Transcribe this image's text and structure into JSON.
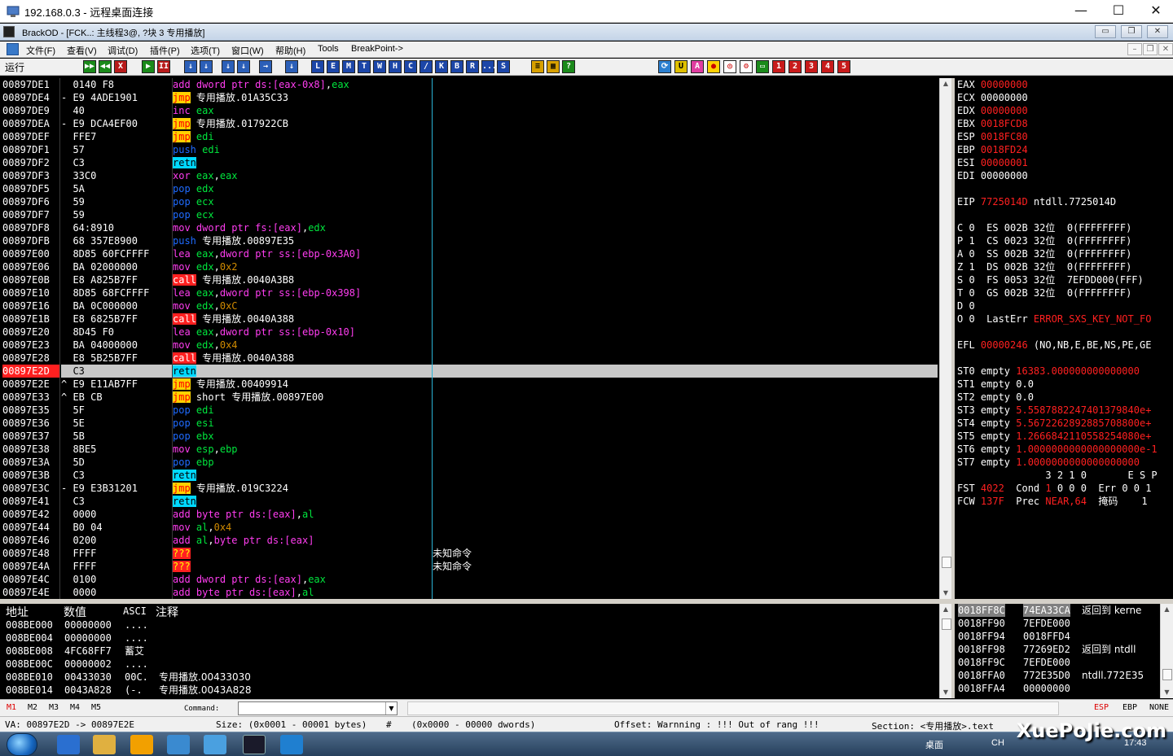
{
  "rdp": {
    "title": "192.168.0.3 - 远程桌面连接",
    "min": "—",
    "max": "☐",
    "close": "✕"
  },
  "od": {
    "title": "BrackOD - [FCK..: 主线程3@, ?块 3 专用播放]"
  },
  "menu": [
    "文件(F)",
    "查看(V)",
    "调试(D)",
    "插件(P)",
    "选项(T)",
    "窗口(W)",
    "帮助(H)",
    "Tools",
    "BreakPoint->"
  ],
  "toolbar": {
    "status": "运行",
    "left_buttons": [
      "▶▶",
      "◀◀",
      "X",
      "▶",
      "II",
      "↓",
      "↓",
      "↓",
      "↓",
      "→",
      "↓"
    ],
    "letter_buttons": [
      "L",
      "E",
      "M",
      "T",
      "W",
      "H",
      "C",
      "/",
      "K",
      "B",
      "R",
      "...",
      "S"
    ],
    "num_buttons": [
      "1",
      "2",
      "3",
      "4",
      "5"
    ]
  },
  "cpu": [
    {
      "addr": "00897DE1",
      "hex": "0140 F8",
      "dis": [
        [
          "op",
          "add"
        ],
        [
          "t",
          " "
        ],
        [
          "kw",
          "dword ptr ds:[eax-0x8]"
        ],
        [
          "t",
          ","
        ],
        [
          "reg",
          "eax"
        ]
      ]
    },
    {
      "addr": "00897DE4",
      "hex": "E9 4ADE1901",
      "mark": "-",
      "dis": [
        [
          "op-jmp",
          "jmp"
        ],
        [
          "t",
          " 专用播放.01A35C33"
        ]
      ]
    },
    {
      "addr": "00897DE9",
      "hex": "40",
      "dis": [
        [
          "op",
          "inc"
        ],
        [
          "t",
          " "
        ],
        [
          "reg",
          "eax"
        ]
      ]
    },
    {
      "addr": "00897DEA",
      "hex": "E9 DCA4EF00",
      "mark": "-",
      "dis": [
        [
          "op-jmp",
          "jmp"
        ],
        [
          "t",
          " 专用播放.017922CB"
        ]
      ]
    },
    {
      "addr": "00897DEF",
      "hex": "FFE7",
      "dis": [
        [
          "op-jmp",
          "jmp"
        ],
        [
          "t",
          " "
        ],
        [
          "reg",
          "edi"
        ]
      ]
    },
    {
      "addr": "00897DF1",
      "hex": "57",
      "dis": [
        [
          "op-push",
          "push"
        ],
        [
          "t",
          " "
        ],
        [
          "reg",
          "edi"
        ]
      ]
    },
    {
      "addr": "00897DF2",
      "hex": "C3",
      "dis": [
        [
          "op-ret",
          "retn"
        ]
      ]
    },
    {
      "addr": "00897DF3",
      "hex": "33C0",
      "dis": [
        [
          "op",
          "xor"
        ],
        [
          "t",
          " "
        ],
        [
          "reg",
          "eax"
        ],
        [
          "t",
          ","
        ],
        [
          "reg",
          "eax"
        ]
      ]
    },
    {
      "addr": "00897DF5",
      "hex": "5A",
      "dis": [
        [
          "op-pop",
          "pop"
        ],
        [
          "t",
          " "
        ],
        [
          "reg",
          "edx"
        ]
      ]
    },
    {
      "addr": "00897DF6",
      "hex": "59",
      "dis": [
        [
          "op-pop",
          "pop"
        ],
        [
          "t",
          " "
        ],
        [
          "reg",
          "ecx"
        ]
      ]
    },
    {
      "addr": "00897DF7",
      "hex": "59",
      "dis": [
        [
          "op-pop",
          "pop"
        ],
        [
          "t",
          " "
        ],
        [
          "reg",
          "ecx"
        ]
      ]
    },
    {
      "addr": "00897DF8",
      "hex": "64:8910",
      "dis": [
        [
          "op",
          "mov"
        ],
        [
          "t",
          " "
        ],
        [
          "kw",
          "dword ptr fs:[eax]"
        ],
        [
          "t",
          ","
        ],
        [
          "reg",
          "edx"
        ]
      ]
    },
    {
      "addr": "00897DFB",
      "hex": "68 357E8900",
      "dis": [
        [
          "op-push",
          "push"
        ],
        [
          "t",
          " 专用播放.00897E35"
        ]
      ]
    },
    {
      "addr": "00897E00",
      "hex": "8D85 60FCFFFF",
      "dis": [
        [
          "op",
          "lea"
        ],
        [
          "t",
          " "
        ],
        [
          "reg",
          "eax"
        ],
        [
          "t",
          ","
        ],
        [
          "kw",
          "dword ptr ss:[ebp-0x3A0]"
        ]
      ]
    },
    {
      "addr": "00897E06",
      "hex": "BA 02000000",
      "dis": [
        [
          "op",
          "mov"
        ],
        [
          "t",
          " "
        ],
        [
          "reg",
          "edx"
        ],
        [
          "t",
          ","
        ],
        [
          "imm",
          "0x2"
        ]
      ]
    },
    {
      "addr": "00897E0B",
      "hex": "E8 A825B7FF",
      "dis": [
        [
          "op-call",
          "call"
        ],
        [
          "t",
          " 专用播放.0040A3B8"
        ]
      ]
    },
    {
      "addr": "00897E10",
      "hex": "8D85 68FCFFFF",
      "dis": [
        [
          "op",
          "lea"
        ],
        [
          "t",
          " "
        ],
        [
          "reg",
          "eax"
        ],
        [
          "t",
          ","
        ],
        [
          "kw",
          "dword ptr ss:[ebp-0x398]"
        ]
      ]
    },
    {
      "addr": "00897E16",
      "hex": "BA 0C000000",
      "dis": [
        [
          "op",
          "mov"
        ],
        [
          "t",
          " "
        ],
        [
          "reg",
          "edx"
        ],
        [
          "t",
          ","
        ],
        [
          "imm",
          "0xC"
        ]
      ]
    },
    {
      "addr": "00897E1B",
      "hex": "E8 6825B7FF",
      "dis": [
        [
          "op-call",
          "call"
        ],
        [
          "t",
          " 专用播放.0040A388"
        ]
      ]
    },
    {
      "addr": "00897E20",
      "hex": "8D45 F0",
      "dis": [
        [
          "op",
          "lea"
        ],
        [
          "t",
          " "
        ],
        [
          "reg",
          "eax"
        ],
        [
          "t",
          ","
        ],
        [
          "kw",
          "dword ptr ss:[ebp-0x10]"
        ]
      ]
    },
    {
      "addr": "00897E23",
      "hex": "BA 04000000",
      "dis": [
        [
          "op",
          "mov"
        ],
        [
          "t",
          " "
        ],
        [
          "reg",
          "edx"
        ],
        [
          "t",
          ","
        ],
        [
          "imm",
          "0x4"
        ]
      ]
    },
    {
      "addr": "00897E28",
      "hex": "E8 5B25B7FF",
      "dis": [
        [
          "op-call",
          "call"
        ],
        [
          "t",
          " 专用播放.0040A388"
        ]
      ]
    },
    {
      "addr": "00897E2D",
      "hex": "C3",
      "hl": true,
      "dis": [
        [
          "op-ret",
          "retn"
        ]
      ]
    },
    {
      "addr": "00897E2E",
      "hex": "E9 E11AB7FF",
      "mark": "^",
      "dis": [
        [
          "op-jmp",
          "jmp"
        ],
        [
          "t",
          " 专用播放.00409914"
        ]
      ]
    },
    {
      "addr": "00897E33",
      "hex": "EB CB",
      "mark": "^",
      "dis": [
        [
          "op-jmp",
          "jmp"
        ],
        [
          "t",
          " short 专用播放.00897E00"
        ]
      ]
    },
    {
      "addr": "00897E35",
      "hex": "5F",
      "dis": [
        [
          "op-pop",
          "pop"
        ],
        [
          "t",
          " "
        ],
        [
          "reg",
          "edi"
        ]
      ]
    },
    {
      "addr": "00897E36",
      "hex": "5E",
      "dis": [
        [
          "op-pop",
          "pop"
        ],
        [
          "t",
          " "
        ],
        [
          "reg",
          "esi"
        ]
      ]
    },
    {
      "addr": "00897E37",
      "hex": "5B",
      "dis": [
        [
          "op-pop",
          "pop"
        ],
        [
          "t",
          " "
        ],
        [
          "reg",
          "ebx"
        ]
      ]
    },
    {
      "addr": "00897E38",
      "hex": "8BE5",
      "dis": [
        [
          "op",
          "mov"
        ],
        [
          "t",
          " "
        ],
        [
          "reg",
          "esp"
        ],
        [
          "t",
          ","
        ],
        [
          "reg",
          "ebp"
        ]
      ]
    },
    {
      "addr": "00897E3A",
      "hex": "5D",
      "dis": [
        [
          "op-pop",
          "pop"
        ],
        [
          "t",
          " "
        ],
        [
          "reg",
          "ebp"
        ]
      ]
    },
    {
      "addr": "00897E3B",
      "hex": "C3",
      "dis": [
        [
          "op-ret",
          "retn"
        ]
      ]
    },
    {
      "addr": "00897E3C",
      "hex": "E9 E3B31201",
      "mark": "-",
      "dis": [
        [
          "op-jmp",
          "jmp"
        ],
        [
          "t",
          " 专用播放.019C3224"
        ]
      ]
    },
    {
      "addr": "00897E41",
      "hex": "C3",
      "dis": [
        [
          "op-ret",
          "retn"
        ]
      ]
    },
    {
      "addr": "00897E42",
      "hex": "0000",
      "dis": [
        [
          "op",
          "add"
        ],
        [
          "t",
          " "
        ],
        [
          "kw",
          "byte ptr ds:[eax]"
        ],
        [
          "t",
          ","
        ],
        [
          "reg",
          "al"
        ]
      ]
    },
    {
      "addr": "00897E44",
      "hex": "B0 04",
      "dis": [
        [
          "op",
          "mov"
        ],
        [
          "t",
          " "
        ],
        [
          "reg",
          "al"
        ],
        [
          "t",
          ","
        ],
        [
          "imm",
          "0x4"
        ]
      ]
    },
    {
      "addr": "00897E46",
      "hex": "0200",
      "dis": [
        [
          "op",
          "add"
        ],
        [
          "t",
          " "
        ],
        [
          "reg",
          "al"
        ],
        [
          "t",
          ","
        ],
        [
          "kw",
          "byte ptr ds:[eax]"
        ]
      ]
    },
    {
      "addr": "00897E48",
      "hex": "FFFF",
      "dis": [
        [
          "op-bad",
          "???"
        ]
      ],
      "cmt": "未知命令"
    },
    {
      "addr": "00897E4A",
      "hex": "FFFF",
      "dis": [
        [
          "op-bad",
          "???"
        ]
      ],
      "cmt": "未知命令"
    },
    {
      "addr": "00897E4C",
      "hex": "0100",
      "dis": [
        [
          "op",
          "add"
        ],
        [
          "t",
          " "
        ],
        [
          "kw",
          "dword ptr ds:[eax]"
        ],
        [
          "t",
          ","
        ],
        [
          "reg",
          "eax"
        ]
      ]
    },
    {
      "addr": "00897E4E",
      "hex": "0000",
      "dis": [
        [
          "op",
          "add"
        ],
        [
          "t",
          " "
        ],
        [
          "kw",
          "byte ptr ds:[eax]"
        ],
        [
          "t",
          ","
        ],
        [
          "reg",
          "al"
        ]
      ]
    }
  ],
  "registers": [
    [
      [
        "w",
        "EAX "
      ],
      [
        "r",
        "00000000"
      ]
    ],
    [
      [
        "w",
        "ECX 00000000"
      ]
    ],
    [
      [
        "w",
        "EDX "
      ],
      [
        "r",
        "00000000"
      ]
    ],
    [
      [
        "w",
        "EBX "
      ],
      [
        "r",
        "0018FCD8"
      ]
    ],
    [
      [
        "w",
        "ESP "
      ],
      [
        "r",
        "0018FC80"
      ]
    ],
    [
      [
        "w",
        "EBP "
      ],
      [
        "r",
        "0018FD24"
      ]
    ],
    [
      [
        "w",
        "ESI "
      ],
      [
        "r",
        "00000001"
      ]
    ],
    [
      [
        "w",
        "EDI 00000000"
      ]
    ],
    [
      [
        "w",
        ""
      ]
    ],
    [
      [
        "w",
        "EIP "
      ],
      [
        "r",
        "7725014D"
      ],
      [
        "w",
        " ntdll.7725014D"
      ]
    ],
    [
      [
        "w",
        ""
      ]
    ],
    [
      [
        "w",
        "C 0  ES 002B 32位  0(FFFFFFFF)"
      ]
    ],
    [
      [
        "w",
        "P 1  CS 0023 32位  0(FFFFFFFF)"
      ]
    ],
    [
      [
        "w",
        "A 0  SS 002B 32位  0(FFFFFFFF)"
      ]
    ],
    [
      [
        "w",
        "Z 1  DS 002B 32位  0(FFFFFFFF)"
      ]
    ],
    [
      [
        "w",
        "S 0  FS 0053 32位  7EFDD000(FFF)"
      ]
    ],
    [
      [
        "w",
        "T 0  GS 002B 32位  0(FFFFFFFF)"
      ]
    ],
    [
      [
        "w",
        "D 0"
      ]
    ],
    [
      [
        "w",
        "O 0  LastErr "
      ],
      [
        "r",
        "ERROR_SXS_KEY_NOT_FO"
      ]
    ],
    [
      [
        "w",
        ""
      ]
    ],
    [
      [
        "w",
        "EFL "
      ],
      [
        "r",
        "00000246"
      ],
      [
        "w",
        " (NO,NB,E,BE,NS,PE,GE"
      ]
    ],
    [
      [
        "w",
        ""
      ]
    ],
    [
      [
        "w",
        "ST0 empty "
      ],
      [
        "r",
        "16383.000000000000000"
      ]
    ],
    [
      [
        "w",
        "ST1 empty 0.0"
      ]
    ],
    [
      [
        "w",
        "ST2 empty 0.0"
      ]
    ],
    [
      [
        "w",
        "ST3 empty "
      ],
      [
        "r",
        "5.5587882247401379840e+"
      ]
    ],
    [
      [
        "w",
        "ST4 empty "
      ],
      [
        "r",
        "5.5672262892885708800e+"
      ]
    ],
    [
      [
        "w",
        "ST5 empty "
      ],
      [
        "r",
        "1.2666842110558254080e+"
      ]
    ],
    [
      [
        "w",
        "ST6 empty "
      ],
      [
        "r",
        "1.0000000000000000000e-1"
      ]
    ],
    [
      [
        "w",
        "ST7 empty "
      ],
      [
        "r",
        "1.0000000000000000000"
      ]
    ],
    [
      [
        "w",
        "               3 2 1 0       E S P"
      ]
    ],
    [
      [
        "w",
        "FST "
      ],
      [
        "r",
        "4022"
      ],
      [
        "w",
        "  Cond "
      ],
      [
        "r",
        "1"
      ],
      [
        "w",
        " 0 0 0  Err 0 0 1"
      ]
    ],
    [
      [
        "w",
        "FCW "
      ],
      [
        "r",
        "137F"
      ],
      [
        "w",
        "  Prec "
      ],
      [
        "r",
        "NEAR,64"
      ],
      [
        "w",
        "  掩码    1"
      ]
    ]
  ],
  "dump": {
    "headers": [
      "地址",
      "数值",
      "ASCI",
      "注释"
    ],
    "rows": [
      [
        "008BE000",
        "00000000",
        "....",
        ""
      ],
      [
        "008BE004",
        "00000000",
        "....",
        ""
      ],
      [
        "008BE008",
        "4FC68FF7",
        "蓄艾",
        ""
      ],
      [
        "008BE00C",
        "00000002",
        "....",
        ""
      ],
      [
        "008BE010",
        "00433030",
        "00C.",
        "专用播放.00433030"
      ],
      [
        "008BE014",
        "0043A828",
        "(-.",
        "专用播放.0043A828"
      ]
    ]
  },
  "stack": [
    [
      "0018FF8C",
      "74EA33CA",
      "返回到 kerne"
    ],
    [
      "0018FF90",
      "7EFDE000",
      ""
    ],
    [
      "0018FF94",
      "0018FFD4",
      ""
    ],
    [
      "0018FF98",
      "77269ED2",
      "返回到 ntdll"
    ],
    [
      "0018FF9C",
      "7EFDE000",
      ""
    ],
    [
      "0018FFA0",
      "772E35D0",
      "ntdll.772E35"
    ],
    [
      "0018FFA4",
      "00000000",
      ""
    ]
  ],
  "cmdbar": {
    "marks": [
      "M1",
      "M2",
      "M3",
      "M4",
      "M5"
    ],
    "label": "Command:",
    "value": "",
    "right": [
      "ESP",
      "EBP",
      "NONE"
    ]
  },
  "statusline": {
    "va": "VA: 00897E2D -> 00897E2E",
    "size": "Size: (0x0001 - 00001 bytes)",
    "hash": "#",
    "dwords": "(0x0000 - 00000 dwords)",
    "offset": "Offset: Warnning : !!! Out of rang !!!",
    "section": "Section: <专用播放>.text"
  },
  "taskbar": {
    "desktop": "桌面",
    "lang": "CH",
    "clock": "17:43"
  },
  "watermark": "XuePoJie.com"
}
